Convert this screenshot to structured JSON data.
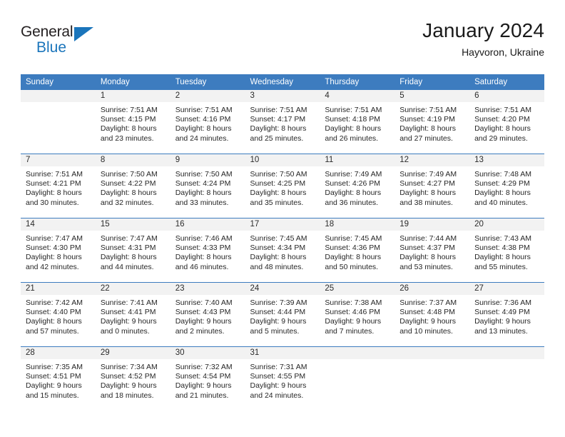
{
  "brand": {
    "name_top": "General",
    "name_bottom": "Blue",
    "accent_color": "#1b75bb"
  },
  "header": {
    "title": "January 2024",
    "subtitle": "Hayvoron, Ukraine"
  },
  "theme": {
    "header_bg": "#3d7cbf",
    "header_text": "#ffffff",
    "daynum_band_bg": "#f2f2f2",
    "row_divider": "#3d7cbf"
  },
  "weekdays": [
    "Sunday",
    "Monday",
    "Tuesday",
    "Wednesday",
    "Thursday",
    "Friday",
    "Saturday"
  ],
  "weeks": [
    [
      {
        "day": "",
        "sunrise": "",
        "sunset": "",
        "daylight1": "",
        "daylight2": ""
      },
      {
        "day": "1",
        "sunrise": "Sunrise: 7:51 AM",
        "sunset": "Sunset: 4:15 PM",
        "daylight1": "Daylight: 8 hours",
        "daylight2": "and 23 minutes."
      },
      {
        "day": "2",
        "sunrise": "Sunrise: 7:51 AM",
        "sunset": "Sunset: 4:16 PM",
        "daylight1": "Daylight: 8 hours",
        "daylight2": "and 24 minutes."
      },
      {
        "day": "3",
        "sunrise": "Sunrise: 7:51 AM",
        "sunset": "Sunset: 4:17 PM",
        "daylight1": "Daylight: 8 hours",
        "daylight2": "and 25 minutes."
      },
      {
        "day": "4",
        "sunrise": "Sunrise: 7:51 AM",
        "sunset": "Sunset: 4:18 PM",
        "daylight1": "Daylight: 8 hours",
        "daylight2": "and 26 minutes."
      },
      {
        "day": "5",
        "sunrise": "Sunrise: 7:51 AM",
        "sunset": "Sunset: 4:19 PM",
        "daylight1": "Daylight: 8 hours",
        "daylight2": "and 27 minutes."
      },
      {
        "day": "6",
        "sunrise": "Sunrise: 7:51 AM",
        "sunset": "Sunset: 4:20 PM",
        "daylight1": "Daylight: 8 hours",
        "daylight2": "and 29 minutes."
      }
    ],
    [
      {
        "day": "7",
        "sunrise": "Sunrise: 7:51 AM",
        "sunset": "Sunset: 4:21 PM",
        "daylight1": "Daylight: 8 hours",
        "daylight2": "and 30 minutes."
      },
      {
        "day": "8",
        "sunrise": "Sunrise: 7:50 AM",
        "sunset": "Sunset: 4:22 PM",
        "daylight1": "Daylight: 8 hours",
        "daylight2": "and 32 minutes."
      },
      {
        "day": "9",
        "sunrise": "Sunrise: 7:50 AM",
        "sunset": "Sunset: 4:24 PM",
        "daylight1": "Daylight: 8 hours",
        "daylight2": "and 33 minutes."
      },
      {
        "day": "10",
        "sunrise": "Sunrise: 7:50 AM",
        "sunset": "Sunset: 4:25 PM",
        "daylight1": "Daylight: 8 hours",
        "daylight2": "and 35 minutes."
      },
      {
        "day": "11",
        "sunrise": "Sunrise: 7:49 AM",
        "sunset": "Sunset: 4:26 PM",
        "daylight1": "Daylight: 8 hours",
        "daylight2": "and 36 minutes."
      },
      {
        "day": "12",
        "sunrise": "Sunrise: 7:49 AM",
        "sunset": "Sunset: 4:27 PM",
        "daylight1": "Daylight: 8 hours",
        "daylight2": "and 38 minutes."
      },
      {
        "day": "13",
        "sunrise": "Sunrise: 7:48 AM",
        "sunset": "Sunset: 4:29 PM",
        "daylight1": "Daylight: 8 hours",
        "daylight2": "and 40 minutes."
      }
    ],
    [
      {
        "day": "14",
        "sunrise": "Sunrise: 7:47 AM",
        "sunset": "Sunset: 4:30 PM",
        "daylight1": "Daylight: 8 hours",
        "daylight2": "and 42 minutes."
      },
      {
        "day": "15",
        "sunrise": "Sunrise: 7:47 AM",
        "sunset": "Sunset: 4:31 PM",
        "daylight1": "Daylight: 8 hours",
        "daylight2": "and 44 minutes."
      },
      {
        "day": "16",
        "sunrise": "Sunrise: 7:46 AM",
        "sunset": "Sunset: 4:33 PM",
        "daylight1": "Daylight: 8 hours",
        "daylight2": "and 46 minutes."
      },
      {
        "day": "17",
        "sunrise": "Sunrise: 7:45 AM",
        "sunset": "Sunset: 4:34 PM",
        "daylight1": "Daylight: 8 hours",
        "daylight2": "and 48 minutes."
      },
      {
        "day": "18",
        "sunrise": "Sunrise: 7:45 AM",
        "sunset": "Sunset: 4:36 PM",
        "daylight1": "Daylight: 8 hours",
        "daylight2": "and 50 minutes."
      },
      {
        "day": "19",
        "sunrise": "Sunrise: 7:44 AM",
        "sunset": "Sunset: 4:37 PM",
        "daylight1": "Daylight: 8 hours",
        "daylight2": "and 53 minutes."
      },
      {
        "day": "20",
        "sunrise": "Sunrise: 7:43 AM",
        "sunset": "Sunset: 4:38 PM",
        "daylight1": "Daylight: 8 hours",
        "daylight2": "and 55 minutes."
      }
    ],
    [
      {
        "day": "21",
        "sunrise": "Sunrise: 7:42 AM",
        "sunset": "Sunset: 4:40 PM",
        "daylight1": "Daylight: 8 hours",
        "daylight2": "and 57 minutes."
      },
      {
        "day": "22",
        "sunrise": "Sunrise: 7:41 AM",
        "sunset": "Sunset: 4:41 PM",
        "daylight1": "Daylight: 9 hours",
        "daylight2": "and 0 minutes."
      },
      {
        "day": "23",
        "sunrise": "Sunrise: 7:40 AM",
        "sunset": "Sunset: 4:43 PM",
        "daylight1": "Daylight: 9 hours",
        "daylight2": "and 2 minutes."
      },
      {
        "day": "24",
        "sunrise": "Sunrise: 7:39 AM",
        "sunset": "Sunset: 4:44 PM",
        "daylight1": "Daylight: 9 hours",
        "daylight2": "and 5 minutes."
      },
      {
        "day": "25",
        "sunrise": "Sunrise: 7:38 AM",
        "sunset": "Sunset: 4:46 PM",
        "daylight1": "Daylight: 9 hours",
        "daylight2": "and 7 minutes."
      },
      {
        "day": "26",
        "sunrise": "Sunrise: 7:37 AM",
        "sunset": "Sunset: 4:48 PM",
        "daylight1": "Daylight: 9 hours",
        "daylight2": "and 10 minutes."
      },
      {
        "day": "27",
        "sunrise": "Sunrise: 7:36 AM",
        "sunset": "Sunset: 4:49 PM",
        "daylight1": "Daylight: 9 hours",
        "daylight2": "and 13 minutes."
      }
    ],
    [
      {
        "day": "28",
        "sunrise": "Sunrise: 7:35 AM",
        "sunset": "Sunset: 4:51 PM",
        "daylight1": "Daylight: 9 hours",
        "daylight2": "and 15 minutes."
      },
      {
        "day": "29",
        "sunrise": "Sunrise: 7:34 AM",
        "sunset": "Sunset: 4:52 PM",
        "daylight1": "Daylight: 9 hours",
        "daylight2": "and 18 minutes."
      },
      {
        "day": "30",
        "sunrise": "Sunrise: 7:32 AM",
        "sunset": "Sunset: 4:54 PM",
        "daylight1": "Daylight: 9 hours",
        "daylight2": "and 21 minutes."
      },
      {
        "day": "31",
        "sunrise": "Sunrise: 7:31 AM",
        "sunset": "Sunset: 4:55 PM",
        "daylight1": "Daylight: 9 hours",
        "daylight2": "and 24 minutes."
      },
      {
        "day": "",
        "sunrise": "",
        "sunset": "",
        "daylight1": "",
        "daylight2": ""
      },
      {
        "day": "",
        "sunrise": "",
        "sunset": "",
        "daylight1": "",
        "daylight2": ""
      },
      {
        "day": "",
        "sunrise": "",
        "sunset": "",
        "daylight1": "",
        "daylight2": ""
      }
    ]
  ]
}
